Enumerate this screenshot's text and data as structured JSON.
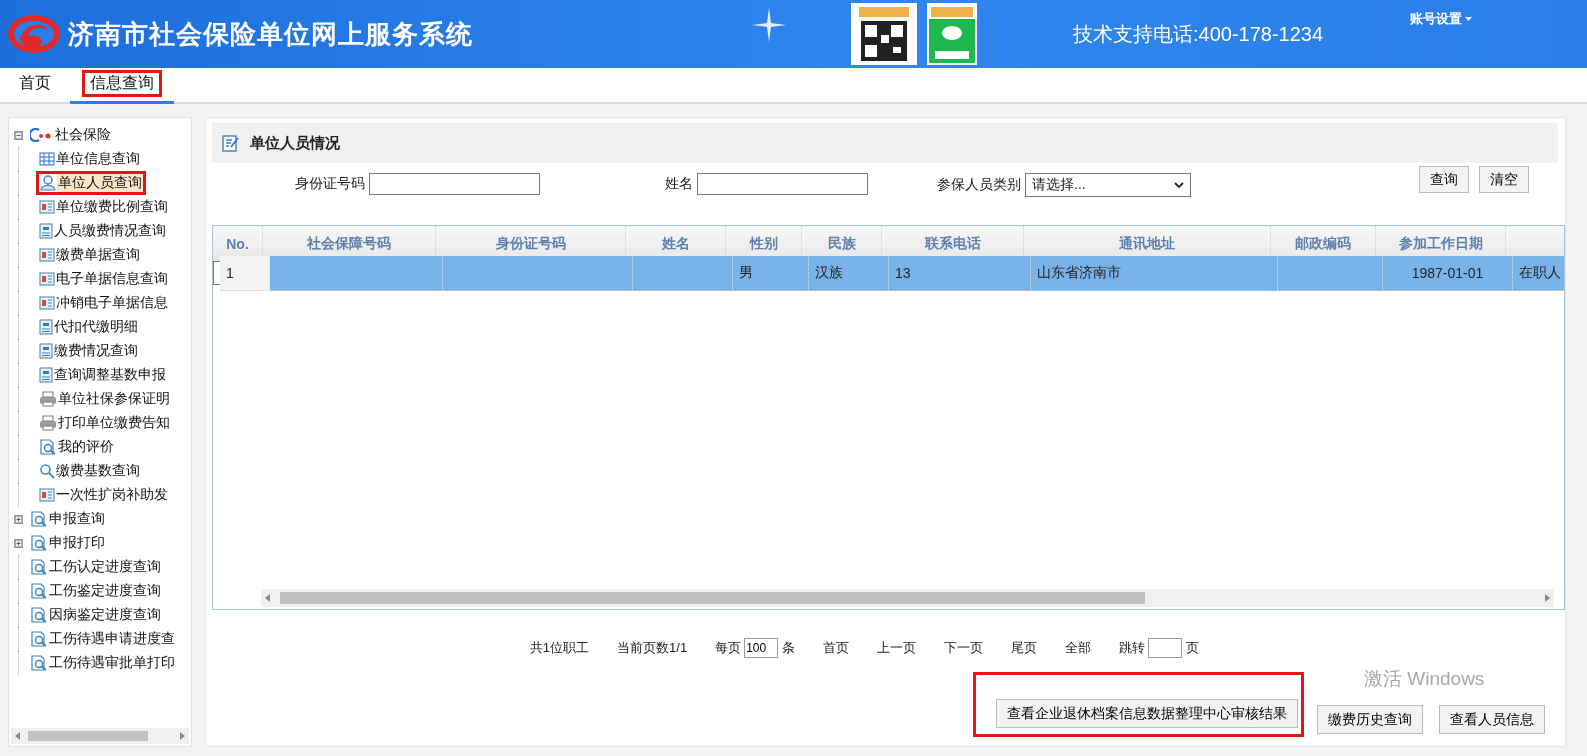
{
  "header": {
    "title": "济南市社会保险单位网上服务系统",
    "support": "技术支持电话:400-178-1234",
    "account_menu": "账号设置"
  },
  "tabs": [
    {
      "label": "首页",
      "selected": false,
      "highlighted": false
    },
    {
      "label": "信息查询",
      "selected": true,
      "highlighted": true
    }
  ],
  "sidebar": {
    "items": [
      {
        "label": "社会保险",
        "kind": "root",
        "expanded": true,
        "selected": false,
        "highlighted": false,
        "children": [
          {
            "label": "单位信息查询",
            "kind": "grid",
            "selected": false,
            "highlighted": false
          },
          {
            "label": "单位人员查询",
            "kind": "person",
            "selected": true,
            "highlighted": true
          },
          {
            "label": "单位缴费比例查询",
            "kind": "receipt",
            "selected": false,
            "highlighted": false
          },
          {
            "label": "人员缴费情况查询",
            "kind": "form",
            "selected": false,
            "highlighted": false
          },
          {
            "label": "缴费单据查询",
            "kind": "receipt",
            "selected": false,
            "highlighted": false
          },
          {
            "label": "电子单据信息查询",
            "kind": "receipt",
            "selected": false,
            "highlighted": false
          },
          {
            "label": "冲销电子单据信息",
            "kind": "receipt",
            "selected": false,
            "highlighted": false
          },
          {
            "label": "代扣代缴明细",
            "kind": "form",
            "selected": false,
            "highlighted": false
          },
          {
            "label": "缴费情况查询",
            "kind": "form",
            "selected": false,
            "highlighted": false
          },
          {
            "label": "查询调整基数申报",
            "kind": "form",
            "selected": false,
            "highlighted": false
          },
          {
            "label": "单位社保参保证明",
            "kind": "printer",
            "selected": false,
            "highlighted": false
          },
          {
            "label": "打印单位缴费告知",
            "kind": "printer",
            "selected": false,
            "highlighted": false
          },
          {
            "label": "我的评价",
            "kind": "report",
            "selected": false,
            "highlighted": false
          },
          {
            "label": "缴费基数查询",
            "kind": "search",
            "selected": false,
            "highlighted": false
          },
          {
            "label": "一次性扩岗补助发",
            "kind": "receipt",
            "selected": false,
            "highlighted": false
          }
        ]
      },
      {
        "label": "申报查询",
        "kind": "report",
        "expanded": false,
        "selected": false,
        "highlighted": false
      },
      {
        "label": "申报打印",
        "kind": "report",
        "expanded": false,
        "selected": false,
        "highlighted": false
      },
      {
        "label": "工伤认定进度查询",
        "kind": "report",
        "selected": false,
        "highlighted": false
      },
      {
        "label": "工伤鉴定进度查询",
        "kind": "report",
        "selected": false,
        "highlighted": false
      },
      {
        "label": "因病鉴定进度查询",
        "kind": "report",
        "selected": false,
        "highlighted": false
      },
      {
        "label": "工伤待遇申请进度查",
        "kind": "report",
        "selected": false,
        "highlighted": false
      },
      {
        "label": "工伤待遇审批单打印",
        "kind": "report",
        "selected": false,
        "highlighted": false
      }
    ]
  },
  "panel": {
    "title": "单位人员情况",
    "filters": [
      {
        "kind": "text",
        "label": "身份证号码"
      },
      {
        "kind": "text",
        "label": "姓名"
      },
      {
        "kind": "select",
        "label": "参保人员类别",
        "value": "请选择..."
      }
    ],
    "buttons": [
      "查询",
      "清空"
    ]
  },
  "table": {
    "columns": [
      "No.",
      "社会保障号码",
      "身份证号码",
      "姓名",
      "性别",
      "民族",
      "联系电话",
      "通讯地址",
      "邮政编码",
      "参加工作日期",
      ""
    ],
    "rows": [
      {
        "selected": true,
        "cells": [
          "1",
          "",
          "",
          "",
          "男",
          "汉族",
          "13",
          "山东省济南市",
          "",
          "1987-01-01",
          "在职人"
        ]
      }
    ]
  },
  "pager": {
    "total": "共1位职工",
    "page": "当前页数1/1",
    "per_page_label": "每页",
    "per_page": "100",
    "per_page_unit": "条",
    "links": [
      "首页",
      "上一页",
      "下一页",
      "尾页",
      "全部"
    ],
    "jump_label": "跳转",
    "jump_unit": "页"
  },
  "actions": [
    {
      "label": "查看企业退休档案信息数据整理中心审核结果",
      "highlighted": true
    },
    {
      "label": "缴费历史查询",
      "highlighted": false
    },
    {
      "label": "查看人员信息",
      "highlighted": false
    }
  ],
  "activation_notice": "激活 Windows"
}
